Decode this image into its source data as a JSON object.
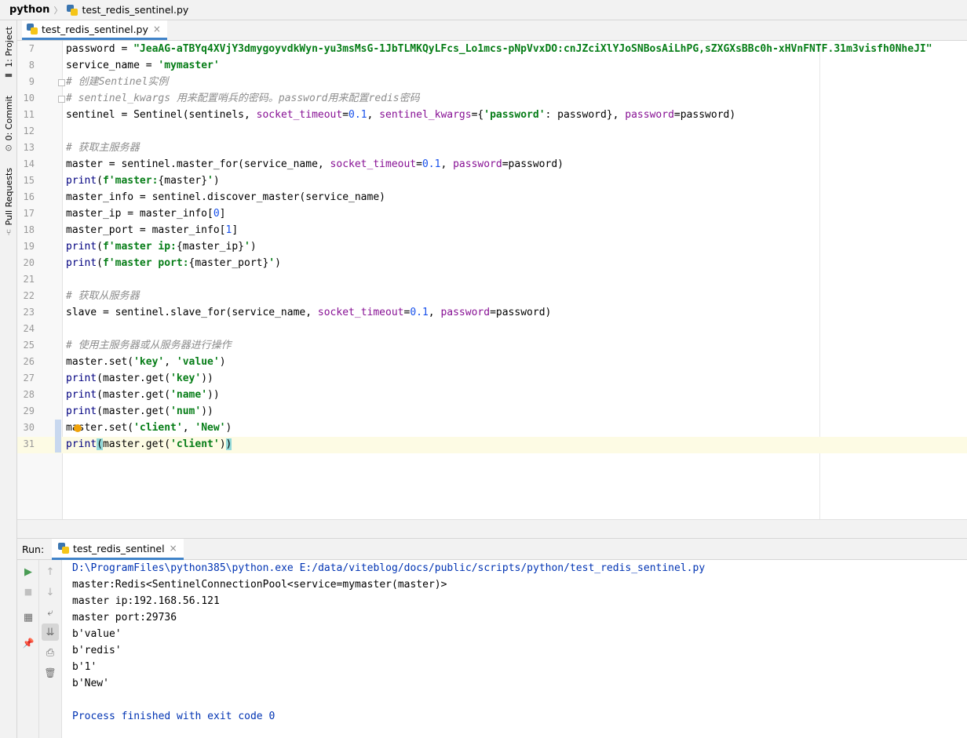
{
  "navbar": {
    "project": "python",
    "file": "test_redis_sentinel.py"
  },
  "tool_stripe": {
    "project_tab": "1: Project",
    "commit_tab": "0: Commit",
    "pull_requests_tab": "Pull Requests"
  },
  "editor_tabs": {
    "active": "test_redis_sentinel.py"
  },
  "editor": {
    "lines": [
      {
        "n": "7",
        "segs": [
          [
            "t",
            "password = "
          ],
          [
            "str",
            "\"JeaAG-aTBYq4XVjY3dmygoyvdkWyn-yu3msMsG-1JbTLMKQyLFcs_Lo1mcs-pNpVvxDO:cnJZciXlYJoSNBosAiLhPG,sZXGXsBBc0h-xHVnFNTF.31m3visfh0NheJI\""
          ]
        ]
      },
      {
        "n": "8",
        "segs": [
          [
            "t",
            "service_name = "
          ],
          [
            "str",
            "'mymaster'"
          ]
        ]
      },
      {
        "n": "9",
        "segs": [
          [
            "cm",
            "# 创建Sentinel实例"
          ]
        ]
      },
      {
        "n": "10",
        "segs": [
          [
            "cm",
            "# sentinel_kwargs 用来配置哨兵的密码。password用来配置redis密码"
          ]
        ]
      },
      {
        "n": "11",
        "segs": [
          [
            "t",
            "sentinel = Sentinel(sentinels, "
          ],
          [
            "kw",
            "socket_timeout"
          ],
          [
            "t",
            "="
          ],
          [
            "num",
            "0.1"
          ],
          [
            "t",
            ", "
          ],
          [
            "kw",
            "sentinel_kwargs"
          ],
          [
            "t",
            "={"
          ],
          [
            "str",
            "'password'"
          ],
          [
            "t",
            ": password}, "
          ],
          [
            "kw",
            "password"
          ],
          [
            "t",
            "=password)"
          ]
        ]
      },
      {
        "n": "12",
        "segs": []
      },
      {
        "n": "13",
        "segs": [
          [
            "cm",
            "# 获取主服务器"
          ]
        ]
      },
      {
        "n": "14",
        "segs": [
          [
            "t",
            "master = sentinel.master_for(service_name, "
          ],
          [
            "kw",
            "socket_timeout"
          ],
          [
            "t",
            "="
          ],
          [
            "num",
            "0.1"
          ],
          [
            "t",
            ", "
          ],
          [
            "kw",
            "password"
          ],
          [
            "t",
            "=password)"
          ]
        ]
      },
      {
        "n": "15",
        "segs": [
          [
            "bi",
            "print"
          ],
          [
            "t",
            "("
          ],
          [
            "fmt",
            "f'master:"
          ],
          [
            "t",
            "{master}"
          ],
          [
            "fmt",
            "'"
          ],
          [
            "t",
            ")"
          ]
        ]
      },
      {
        "n": "16",
        "segs": [
          [
            "t",
            "master_info = sentinel.discover_master(service_name)"
          ]
        ]
      },
      {
        "n": "17",
        "segs": [
          [
            "t",
            "master_ip = master_info["
          ],
          [
            "num",
            "0"
          ],
          [
            "t",
            "]"
          ]
        ]
      },
      {
        "n": "18",
        "segs": [
          [
            "t",
            "master_port = master_info["
          ],
          [
            "num",
            "1"
          ],
          [
            "t",
            "]"
          ]
        ]
      },
      {
        "n": "19",
        "segs": [
          [
            "bi",
            "print"
          ],
          [
            "t",
            "("
          ],
          [
            "fmt",
            "f'master ip:"
          ],
          [
            "t",
            "{master_ip}"
          ],
          [
            "fmt",
            "'"
          ],
          [
            "t",
            ")"
          ]
        ]
      },
      {
        "n": "20",
        "segs": [
          [
            "bi",
            "print"
          ],
          [
            "t",
            "("
          ],
          [
            "fmt",
            "f'master port:"
          ],
          [
            "t",
            "{master_port}"
          ],
          [
            "fmt",
            "'"
          ],
          [
            "t",
            ")"
          ]
        ]
      },
      {
        "n": "21",
        "segs": []
      },
      {
        "n": "22",
        "segs": [
          [
            "cm",
            "# 获取从服务器"
          ]
        ]
      },
      {
        "n": "23",
        "segs": [
          [
            "t",
            "slave = sentinel.slave_for(service_name, "
          ],
          [
            "kw",
            "socket_timeout"
          ],
          [
            "t",
            "="
          ],
          [
            "num",
            "0.1"
          ],
          [
            "t",
            ", "
          ],
          [
            "kw",
            "password"
          ],
          [
            "t",
            "=password)"
          ]
        ]
      },
      {
        "n": "24",
        "segs": []
      },
      {
        "n": "25",
        "segs": [
          [
            "cm",
            "# 使用主服务器或从服务器进行操作"
          ]
        ]
      },
      {
        "n": "26",
        "segs": [
          [
            "t",
            "master.set("
          ],
          [
            "str",
            "'key'"
          ],
          [
            "t",
            ", "
          ],
          [
            "str",
            "'value'"
          ],
          [
            "t",
            ")"
          ]
        ]
      },
      {
        "n": "27",
        "segs": [
          [
            "bi",
            "print"
          ],
          [
            "t",
            "(master.get("
          ],
          [
            "str",
            "'key'"
          ],
          [
            "t",
            "))"
          ]
        ]
      },
      {
        "n": "28",
        "segs": [
          [
            "bi",
            "print"
          ],
          [
            "t",
            "(master.get("
          ],
          [
            "str",
            "'name'"
          ],
          [
            "t",
            "))"
          ]
        ]
      },
      {
        "n": "29",
        "segs": [
          [
            "bi",
            "print"
          ],
          [
            "t",
            "(master.get("
          ],
          [
            "str",
            "'num'"
          ],
          [
            "t",
            "))"
          ]
        ]
      },
      {
        "n": "30",
        "segs": [
          [
            "t",
            "master.set("
          ],
          [
            "str",
            "'client'"
          ],
          [
            "t",
            ", "
          ],
          [
            "str",
            "'New'"
          ],
          [
            "t",
            ")"
          ]
        ]
      },
      {
        "n": "31",
        "segs": [
          [
            "bi",
            "print"
          ],
          [
            "br",
            "("
          ],
          [
            "t",
            "master.get("
          ],
          [
            "str",
            "'client'"
          ],
          [
            "t",
            ")"
          ],
          [
            "br",
            ")"
          ]
        ]
      }
    ]
  },
  "run_panel": {
    "label": "Run:",
    "tab": "test_redis_sentinel",
    "output": [
      {
        "cls": "path",
        "text": "D:\\ProgramFiles\\python385\\python.exe E:/data/viteblog/docs/public/scripts/python/test_redis_sentinel.py"
      },
      {
        "cls": "",
        "text": "master:Redis<SentinelConnectionPool<service=mymaster(master)>"
      },
      {
        "cls": "",
        "text": "master ip:192.168.56.121"
      },
      {
        "cls": "",
        "text": "master port:29736"
      },
      {
        "cls": "",
        "text": "b'value'"
      },
      {
        "cls": "",
        "text": "b'redis'"
      },
      {
        "cls": "",
        "text": "b'1'"
      },
      {
        "cls": "",
        "text": "b'New'"
      },
      {
        "cls": "",
        "text": ""
      },
      {
        "cls": "exit",
        "text": "Process finished with exit code 0"
      }
    ]
  },
  "icons": {
    "rerun": "▶",
    "stop": "■",
    "up": "↑",
    "down": "↓",
    "wrap": "⤶",
    "scroll_end": "⇊",
    "layout": "▦",
    "pin": "📌",
    "print": "⎙",
    "trash": "🗑"
  },
  "colors": {
    "accent": "#4083c9",
    "string": "#067d17",
    "keyword_arg": "#871094",
    "number": "#1750eb",
    "comment": "#8c8c8c",
    "run_green": "#499c54"
  }
}
